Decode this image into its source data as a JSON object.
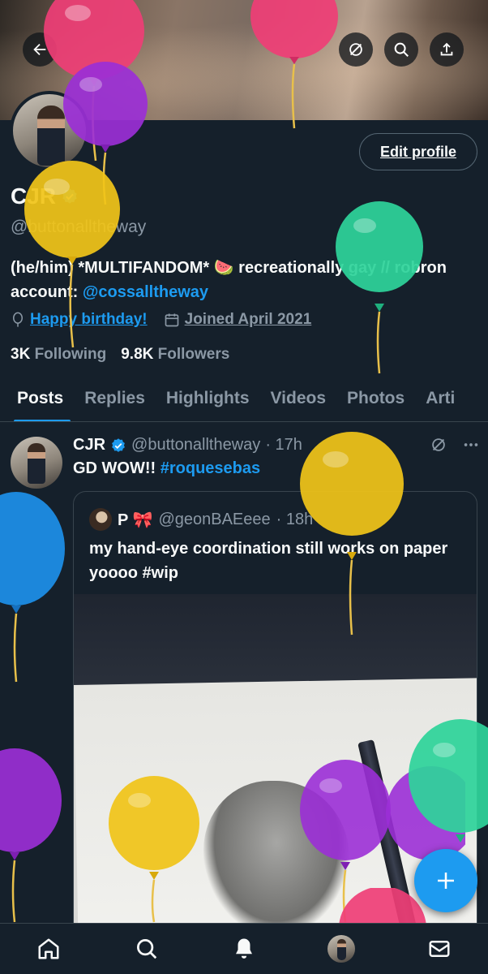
{
  "header": {
    "back_icon": "arrow-left-icon",
    "actions": [
      "grok-icon",
      "search-icon",
      "share-icon"
    ]
  },
  "profile": {
    "name": "CJR",
    "handle": "@buttonalltheway",
    "edit_label": "Edit profile",
    "bio_text": "(he/him) *MULTIFANDOM* 🍉 recreationally gay // robron account: ",
    "bio_link": "@cossalltheway",
    "birthday": "Happy birthday!",
    "joined": "Joined April 2021",
    "following_count": "3K",
    "following_label": "Following",
    "followers_count": "9.8K",
    "followers_label": "Followers"
  },
  "tabs": [
    "Posts",
    "Replies",
    "Highlights",
    "Videos",
    "Photos",
    "Arti"
  ],
  "post": {
    "name": "CJR",
    "handle": "@buttonalltheway",
    "time": "· 17h",
    "text_plain": "GD WOW!! ",
    "hashtag": "#roquesebas",
    "quote": {
      "name": "P 🎀",
      "handle": "@geonBAEeee",
      "time": "· 18h",
      "text": "my hand-eye coordination still works on paper yoooo #wip"
    }
  },
  "fab_label": "+",
  "bottom_nav": [
    "home-icon",
    "search-icon",
    "notifications-bell-icon",
    "profile-avatar",
    "messages-icon"
  ],
  "colors": {
    "background": "#15202b",
    "accent": "#1d9bf0",
    "muted": "#8b98a5",
    "border": "#38444d",
    "balloon_pink": "#ef3e76",
    "balloon_purple": "#9b2fd6",
    "balloon_yellow": "#f0c419",
    "balloon_green": "#2ed39a",
    "balloon_blue": "#1d8fe8"
  }
}
